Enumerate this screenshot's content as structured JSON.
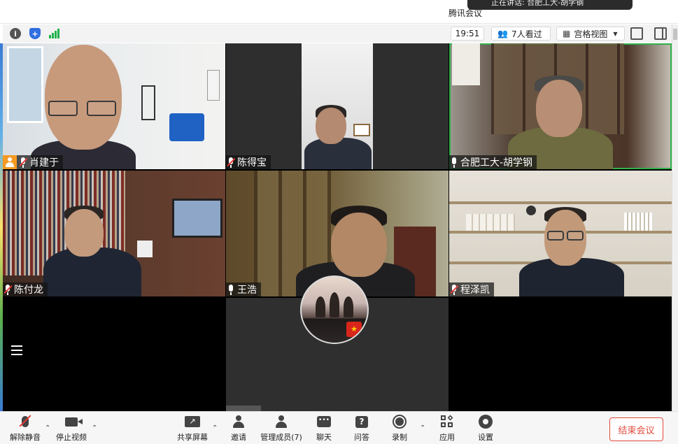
{
  "window": {
    "title": "腾讯会议"
  },
  "notification": {
    "text": "正在讲话: 合肥工大-胡学钢"
  },
  "topbar": {
    "time": "19:51",
    "viewers": "7人看过",
    "view_mode": "宫格视图"
  },
  "participants": [
    {
      "name": "肖建于",
      "mic": "muted",
      "host": true
    },
    {
      "name": "陈得宝",
      "mic": "muted",
      "host": false
    },
    {
      "name": "合肥工大-胡学钢",
      "mic": "on",
      "host": false,
      "speaking": true
    },
    {
      "name": "陈付龙",
      "mic": "muted",
      "host": false
    },
    {
      "name": "王浩",
      "mic": "on",
      "host": false
    },
    {
      "name": "程泽凯",
      "mic": "muted",
      "host": false
    }
  ],
  "bottombar": {
    "unmute": "解除静音",
    "stop_video": "停止视频",
    "share": "共享屏幕",
    "invite": "邀请",
    "manage": "管理成员(7)",
    "chat": "聊天",
    "qa": "问答",
    "record": "录制",
    "apps": "应用",
    "settings": "设置",
    "end": "结束会议"
  },
  "colors": {
    "speaking_border": "#2fb04b",
    "end_button": "#e04a3d",
    "host_badge": "#f59a23",
    "muted_mic": "#e53935"
  }
}
